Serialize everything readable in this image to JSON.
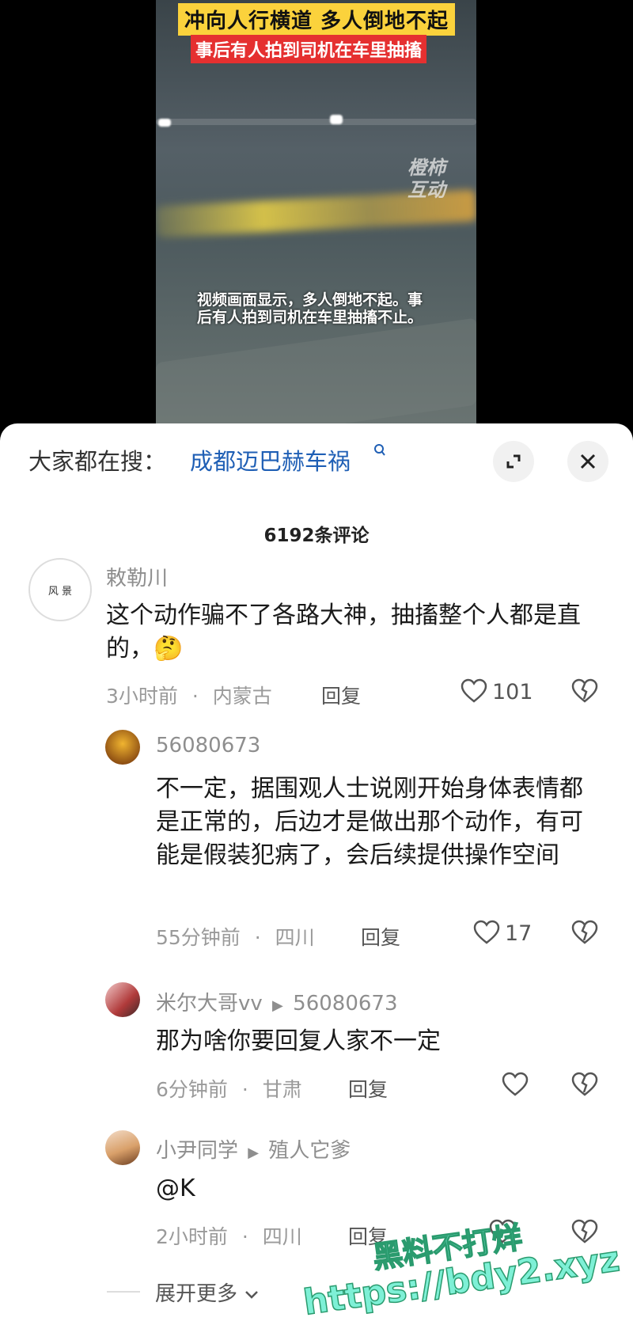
{
  "video": {
    "caption_line1": "冲向人行横道 多人倒地不起",
    "caption_line2": "事后有人拍到司机在车里抽搐",
    "watermark": "橙柿\n互动",
    "subtitle": "视频画面显示，多人倒地不起。事后有人拍到司机在车里抽搐不止。"
  },
  "search": {
    "label": "大家都在搜：",
    "term": "成都迈巴赫车祸",
    "term_icon": "search-icon"
  },
  "comments_count": "6192条评论",
  "comments": [
    {
      "username": "敕勒川",
      "avatar_text": "风 景",
      "text": "这个动作骗不了各路大神，抽搐整个人都是直的，",
      "emoji": "🤔",
      "time": "3小时前",
      "location": "内蒙古",
      "reply_label": "回复",
      "likes": "101"
    },
    {
      "username": "56080673",
      "text": "不一定，据围观人士说刚开始身体表情都是正常的，后边才是做出那个动作，有可能是假装犯病了，会后续提供操作空间",
      "time": "55分钟前",
      "location": "四川",
      "reply_label": "回复",
      "likes": "17"
    },
    {
      "username": "米尔大哥vv",
      "reply_to": "56080673",
      "text": "那为啥你要回复人家不一定",
      "time": "6分钟前",
      "location": "甘肃",
      "reply_label": "回复",
      "likes": ""
    },
    {
      "username": "小尹同学",
      "reply_to": "殖人它爹",
      "text": "@K",
      "time": "2小时前",
      "location": "四川",
      "reply_label": "回复",
      "likes": ""
    }
  ],
  "meta_separator": "·",
  "reply_arrow": "▶",
  "expand_more": "展开更多",
  "promo_overlay": {
    "line1": "黑料不打烊",
    "line2": "https://bdy2.xyz"
  },
  "colors": {
    "link_blue": "#1f5fb5",
    "caption_yellow": "#fbd23c",
    "caption_red": "#e53030",
    "promo_green": "#7ef0d6"
  }
}
